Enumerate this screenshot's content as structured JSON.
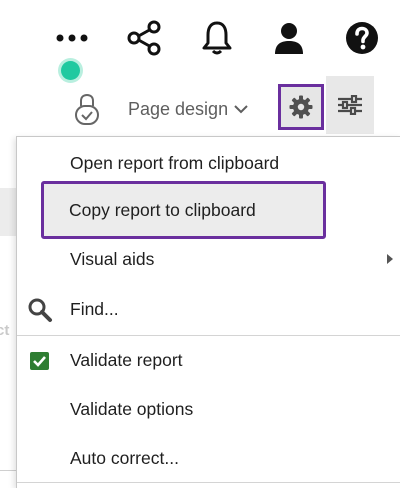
{
  "header": {
    "icons": [
      "more-icon",
      "share-icon",
      "bell-icon",
      "user-icon",
      "help-icon"
    ]
  },
  "toolbar": {
    "page_design_label": "Page design"
  },
  "menu": {
    "items": [
      {
        "label": "Open report from clipboard"
      },
      {
        "label": "Copy report to clipboard",
        "highlighted": true
      },
      {
        "label": "Visual aids",
        "submenu": true
      },
      {
        "label": "Find...",
        "icon": "search-icon"
      },
      {
        "label": "Validate report",
        "icon": "checkbox-checked-icon"
      },
      {
        "label": "Validate options"
      },
      {
        "label": "Auto correct..."
      }
    ]
  },
  "background": {
    "partial_text": "ct"
  },
  "colors": {
    "accent_purple": "#6a2f9e",
    "status_green": "#20c9a0",
    "check_green": "#2e7d32"
  }
}
